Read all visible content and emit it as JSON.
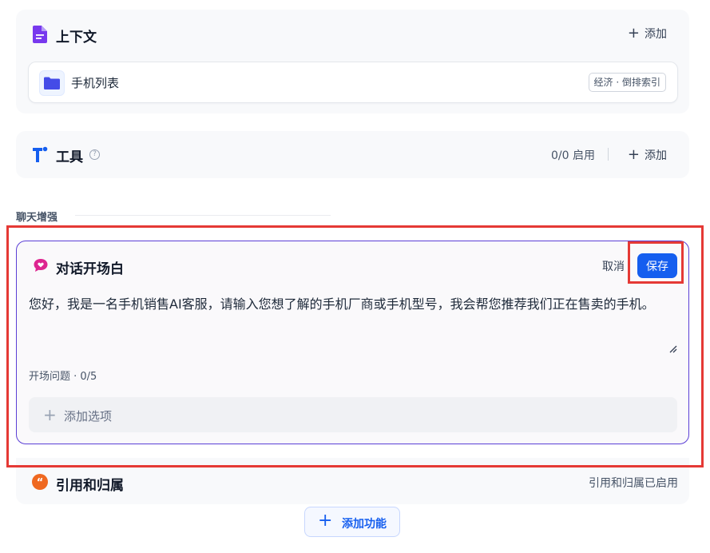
{
  "context": {
    "title": "上下文",
    "add_label": "添加",
    "dataset": {
      "name": "手机列表",
      "badge": "经济 · 倒排索引"
    }
  },
  "tools": {
    "title": "工具",
    "help": "?",
    "enabled": "0/0 启用",
    "add_label": "添加"
  },
  "section": {
    "label": "聊天增强"
  },
  "opener": {
    "title": "对话开场白",
    "cancel_label": "取消",
    "save_label": "保存",
    "text": "您好，我是一名手机销售AI客服，请输入您想了解的手机厂商或手机型号，我会帮您推荐我们正在售卖的手机。",
    "questions_label": "开场问题 · 0/5",
    "add_option_label": "添加选项"
  },
  "citation": {
    "title": "引用和归属",
    "status": "引用和归属已启用"
  },
  "add_feature": {
    "label": "添加功能"
  },
  "colors": {
    "accent": "#155eef",
    "highlight": "#e53935",
    "focus_border": "#5b3fd6",
    "context_icon": "#7839ee",
    "opener_icon": "#dd2590",
    "citation_icon": "#ef6820"
  }
}
